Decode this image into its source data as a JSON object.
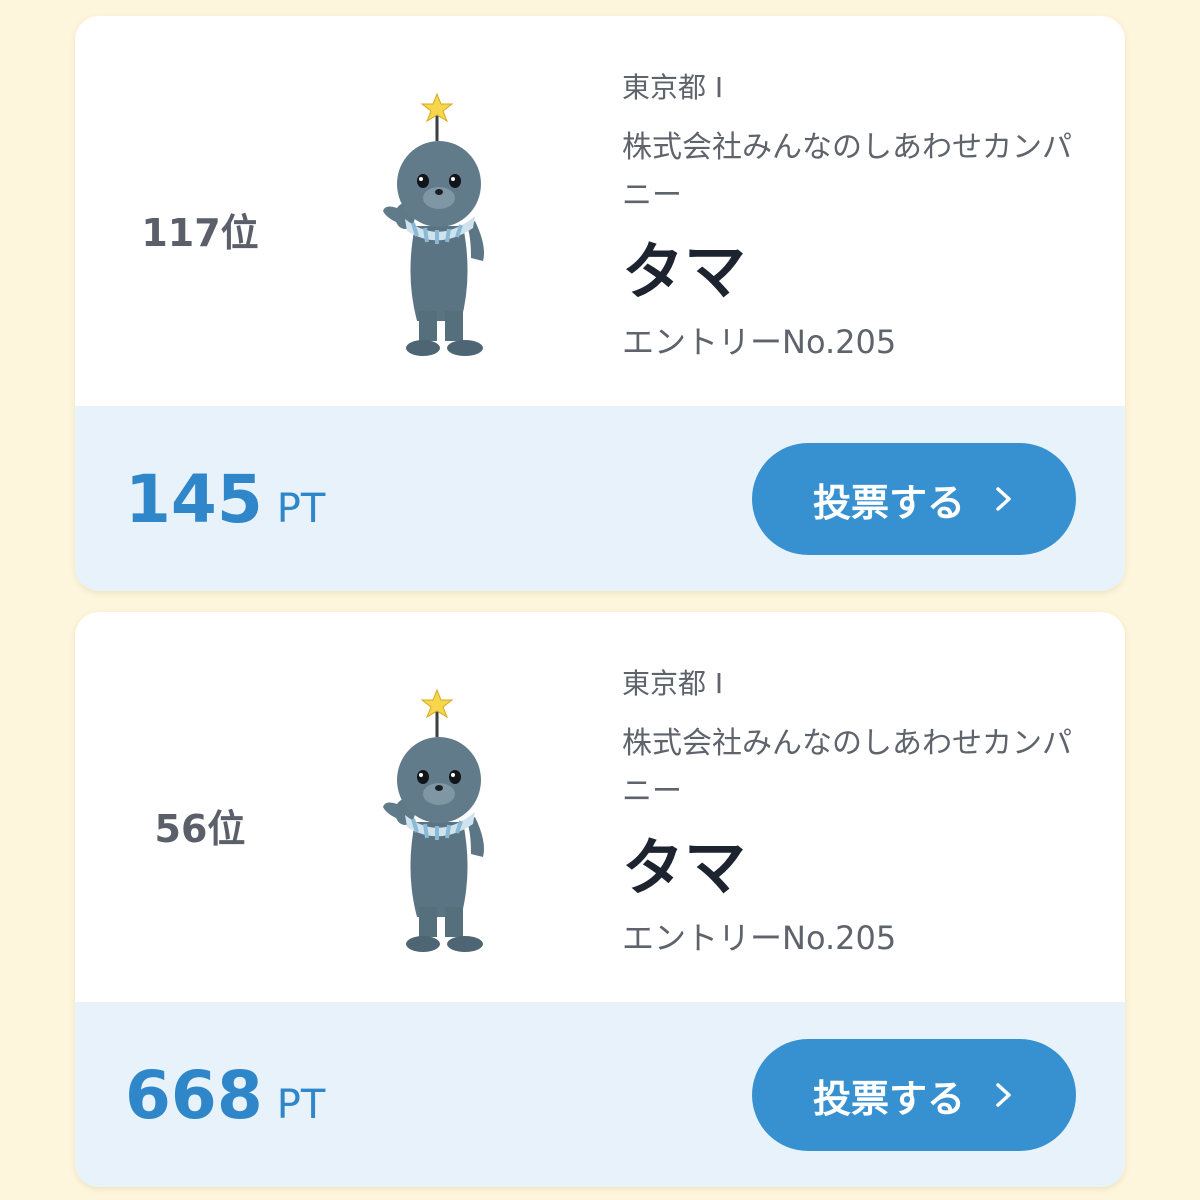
{
  "cards": [
    {
      "rank": "117位",
      "prefecture": "東京都 I",
      "company": "株式会社みんなのしあわせカンパニー",
      "name": "タマ",
      "entry": "エントリーNo.205",
      "points": "145",
      "points_unit": "PT",
      "vote_label": "投票する"
    },
    {
      "rank": "56位",
      "prefecture": "東京都 I",
      "company": "株式会社みんなのしあわせカンパニー",
      "name": "タマ",
      "entry": "エントリーNo.205",
      "points": "668",
      "points_unit": "PT",
      "vote_label": "投票する"
    }
  ],
  "colors": {
    "page_bg": "#fdf6dc",
    "accent": "#2f87c9",
    "button": "#3791d1",
    "footer_bg": "#e8f2fa"
  },
  "icons": {
    "vote_chevron": "chevron-right-icon",
    "mascot": "mascot-image"
  }
}
